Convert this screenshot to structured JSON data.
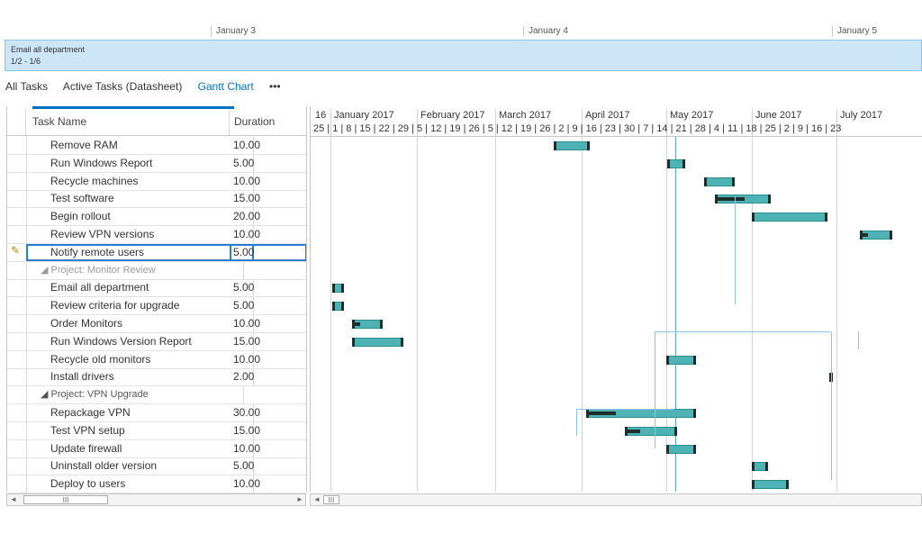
{
  "timeline": {
    "dates": [
      "January 3",
      "January 4",
      "January 5"
    ],
    "band_title": "Email all department",
    "band_range": "1/2 - 1/6"
  },
  "tabs": [
    "All Tasks",
    "Active Tasks (Datasheet)",
    "Gantt Chart",
    "•••"
  ],
  "grid": {
    "header_task": "Task Name",
    "header_duration": "Duration",
    "rows": [
      {
        "name": "Remove RAM",
        "dur": "10.00"
      },
      {
        "name": "Run Windows Report",
        "dur": "5.00"
      },
      {
        "name": "Recycle machines",
        "dur": "10.00"
      },
      {
        "name": "Test software",
        "dur": "15.00"
      },
      {
        "name": "Begin rollout",
        "dur": "20.00"
      },
      {
        "name": "Review VPN versions",
        "dur": "10.00"
      },
      {
        "name": "Notify remote users",
        "dur": "5.00"
      },
      {
        "name": "◢ Project: Monitor Review",
        "dur": ""
      },
      {
        "name": "Email all department",
        "dur": "5.00"
      },
      {
        "name": "Review criteria for upgrade",
        "dur": "5.00"
      },
      {
        "name": "Order Monitors",
        "dur": "10.00"
      },
      {
        "name": "Run Windows Version Report",
        "dur": "15.00"
      },
      {
        "name": "Recycle old monitors",
        "dur": "10.00"
      },
      {
        "name": "Install drivers",
        "dur": "2.00"
      },
      {
        "name": "◢ Project: VPN Upgrade",
        "dur": ""
      },
      {
        "name": "Repackage VPN",
        "dur": "30.00"
      },
      {
        "name": "Test VPN setup",
        "dur": "15.00"
      },
      {
        "name": "Update firewall",
        "dur": "10.00"
      },
      {
        "name": "Uninstall older version",
        "dur": "5.00"
      },
      {
        "name": "Deploy to users",
        "dur": "10.00"
      }
    ]
  },
  "gantt": {
    "months": [
      "16",
      "January 2017",
      "February 2017",
      "March 2017",
      "April 2017",
      "May 2017",
      "June 2017",
      "July 2017"
    ],
    "days": "25 | 1 | 8 | 15 | 22 | 29 | 5 | 12 | 19 | 26 | 5 | 12 | 19 | 26 | 2 | 9 | 16 | 23 | 30 | 7 | 14 | 21 | 28 | 4 | 11 | 18 | 25 | 2 | 9 | 16 | 23"
  },
  "scroll_label": "III",
  "colors": {
    "accent": "#0072c6",
    "bar": "#4fb3b5",
    "band": "#cde6f7"
  }
}
